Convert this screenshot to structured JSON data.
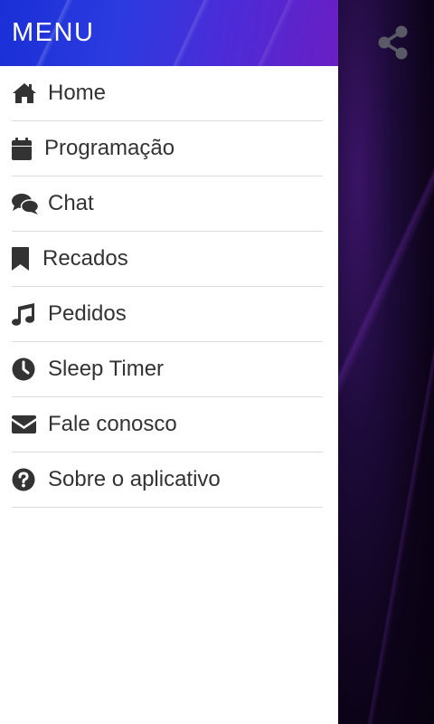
{
  "header": {
    "title": "MENU"
  },
  "menu": {
    "items": [
      {
        "label": "Home",
        "icon": "home-icon"
      },
      {
        "label": "Programação",
        "icon": "calendar-icon"
      },
      {
        "label": "Chat",
        "icon": "chat-icon"
      },
      {
        "label": "Recados",
        "icon": "bookmark-icon"
      },
      {
        "label": "Pedidos",
        "icon": "music-note-icon"
      },
      {
        "label": "Sleep Timer",
        "icon": "clock-icon"
      },
      {
        "label": "Fale conosco",
        "icon": "envelope-icon"
      },
      {
        "label": "Sobre o aplicativo",
        "icon": "question-circle-icon"
      }
    ]
  },
  "toolbar": {
    "share_icon": "share-icon"
  },
  "colors": {
    "header_start": "#1a2fd6",
    "header_end": "#6a1fc4",
    "text": "#333333",
    "divider": "#dcdcdc",
    "icon": "#333333",
    "share_icon": "#5a5a66"
  }
}
